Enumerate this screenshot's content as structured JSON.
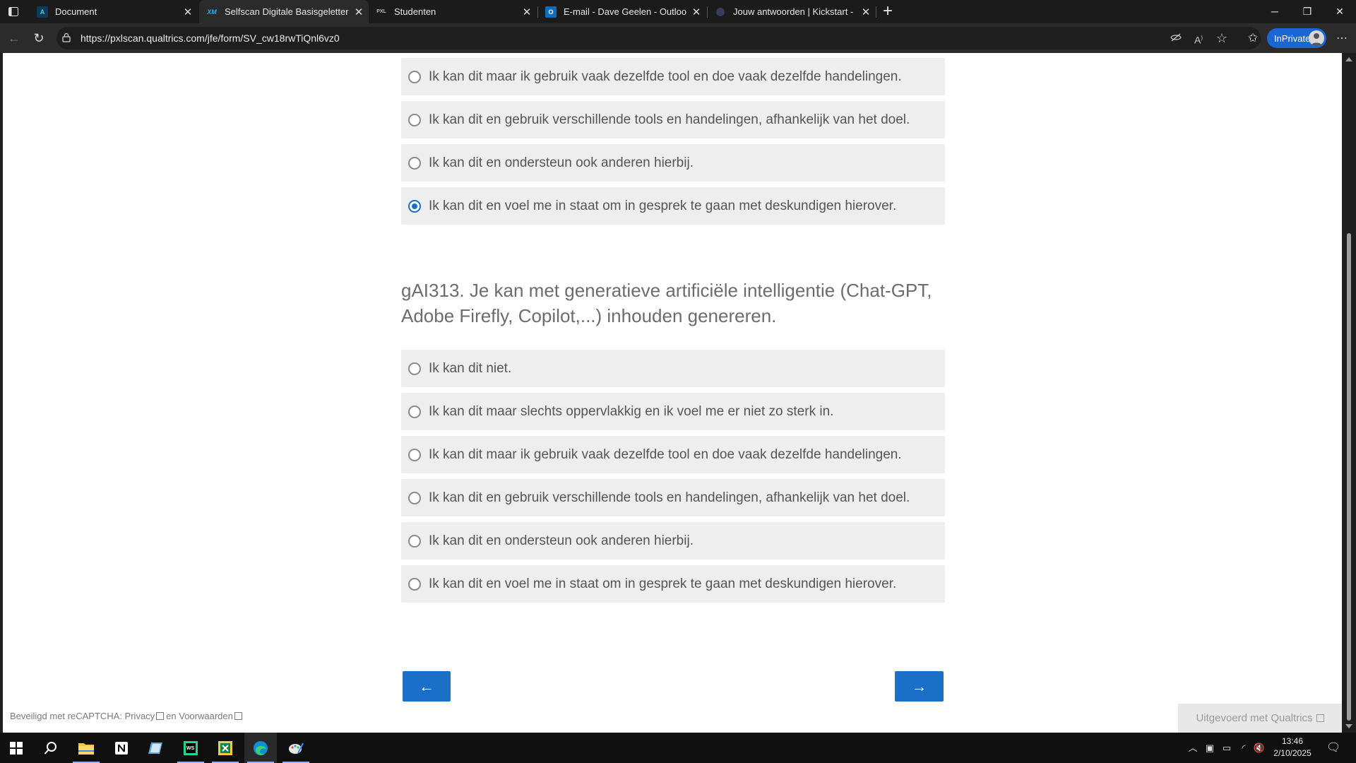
{
  "browser": {
    "tabs": [
      {
        "title": "Document",
        "favicon": "A"
      },
      {
        "title": "Selfscan Digitale Basisgeletterdheid",
        "favicon": "XM"
      },
      {
        "title": "Studenten",
        "favicon": "PXL"
      },
      {
        "title": "E-mail - Dave Geelen - Outlook",
        "favicon": "O"
      },
      {
        "title": "Jouw antwoorden | Kickstart - Leren",
        "favicon": ""
      }
    ],
    "url": "https://pxlscan.qualtrics.com/jfe/form/SV_cw18rwTiQnl6vz0",
    "inprivate_label": "InPrivate"
  },
  "survey": {
    "prev_choices": [
      {
        "label": "Ik kan dit maar ik gebruik vaak dezelfde tool en doe vaak dezelfde handelingen.",
        "selected": false
      },
      {
        "label": "Ik kan dit en gebruik verschillende tools en handelingen, afhankelijk van het doel.",
        "selected": false
      },
      {
        "label": "Ik kan dit en ondersteun ook anderen hierbij.",
        "selected": false
      },
      {
        "label": "Ik kan dit en voel me in staat om in gesprek te gaan met deskundigen hierover.",
        "selected": true
      }
    ],
    "question": "gAI313. Je kan met generatieve artificiële intelligentie (Chat-GPT, Adobe Firefly, Copilot,...) inhouden genereren.",
    "choices": [
      {
        "label": "Ik kan dit niet.",
        "selected": false
      },
      {
        "label": "Ik kan dit maar slechts oppervlakkig en ik voel me er niet zo sterk in.",
        "selected": false
      },
      {
        "label": "Ik kan dit maar ik gebruik vaak dezelfde tool en doe vaak dezelfde handelingen.",
        "selected": false
      },
      {
        "label": "Ik kan dit en gebruik verschillende tools en handelingen, afhankelijk van het doel.",
        "selected": false
      },
      {
        "label": "Ik kan dit en ondersteun ook anderen hierbij.",
        "selected": false
      },
      {
        "label": "Ik kan dit en voel me in staat om in gesprek te gaan met deskundigen hierover.",
        "selected": false
      }
    ],
    "back_button": "←",
    "next_button": "→",
    "recaptcha": {
      "prefix": "Beveiligd met reCAPTCHA: Privacy",
      "middle": "en Voorwaarden"
    },
    "powered_by": "Uitgevoerd met Qualtrics",
    "accent_color": "#1a6fc6"
  },
  "taskbar": {
    "time": "13:46",
    "date": "2/10/2025"
  }
}
